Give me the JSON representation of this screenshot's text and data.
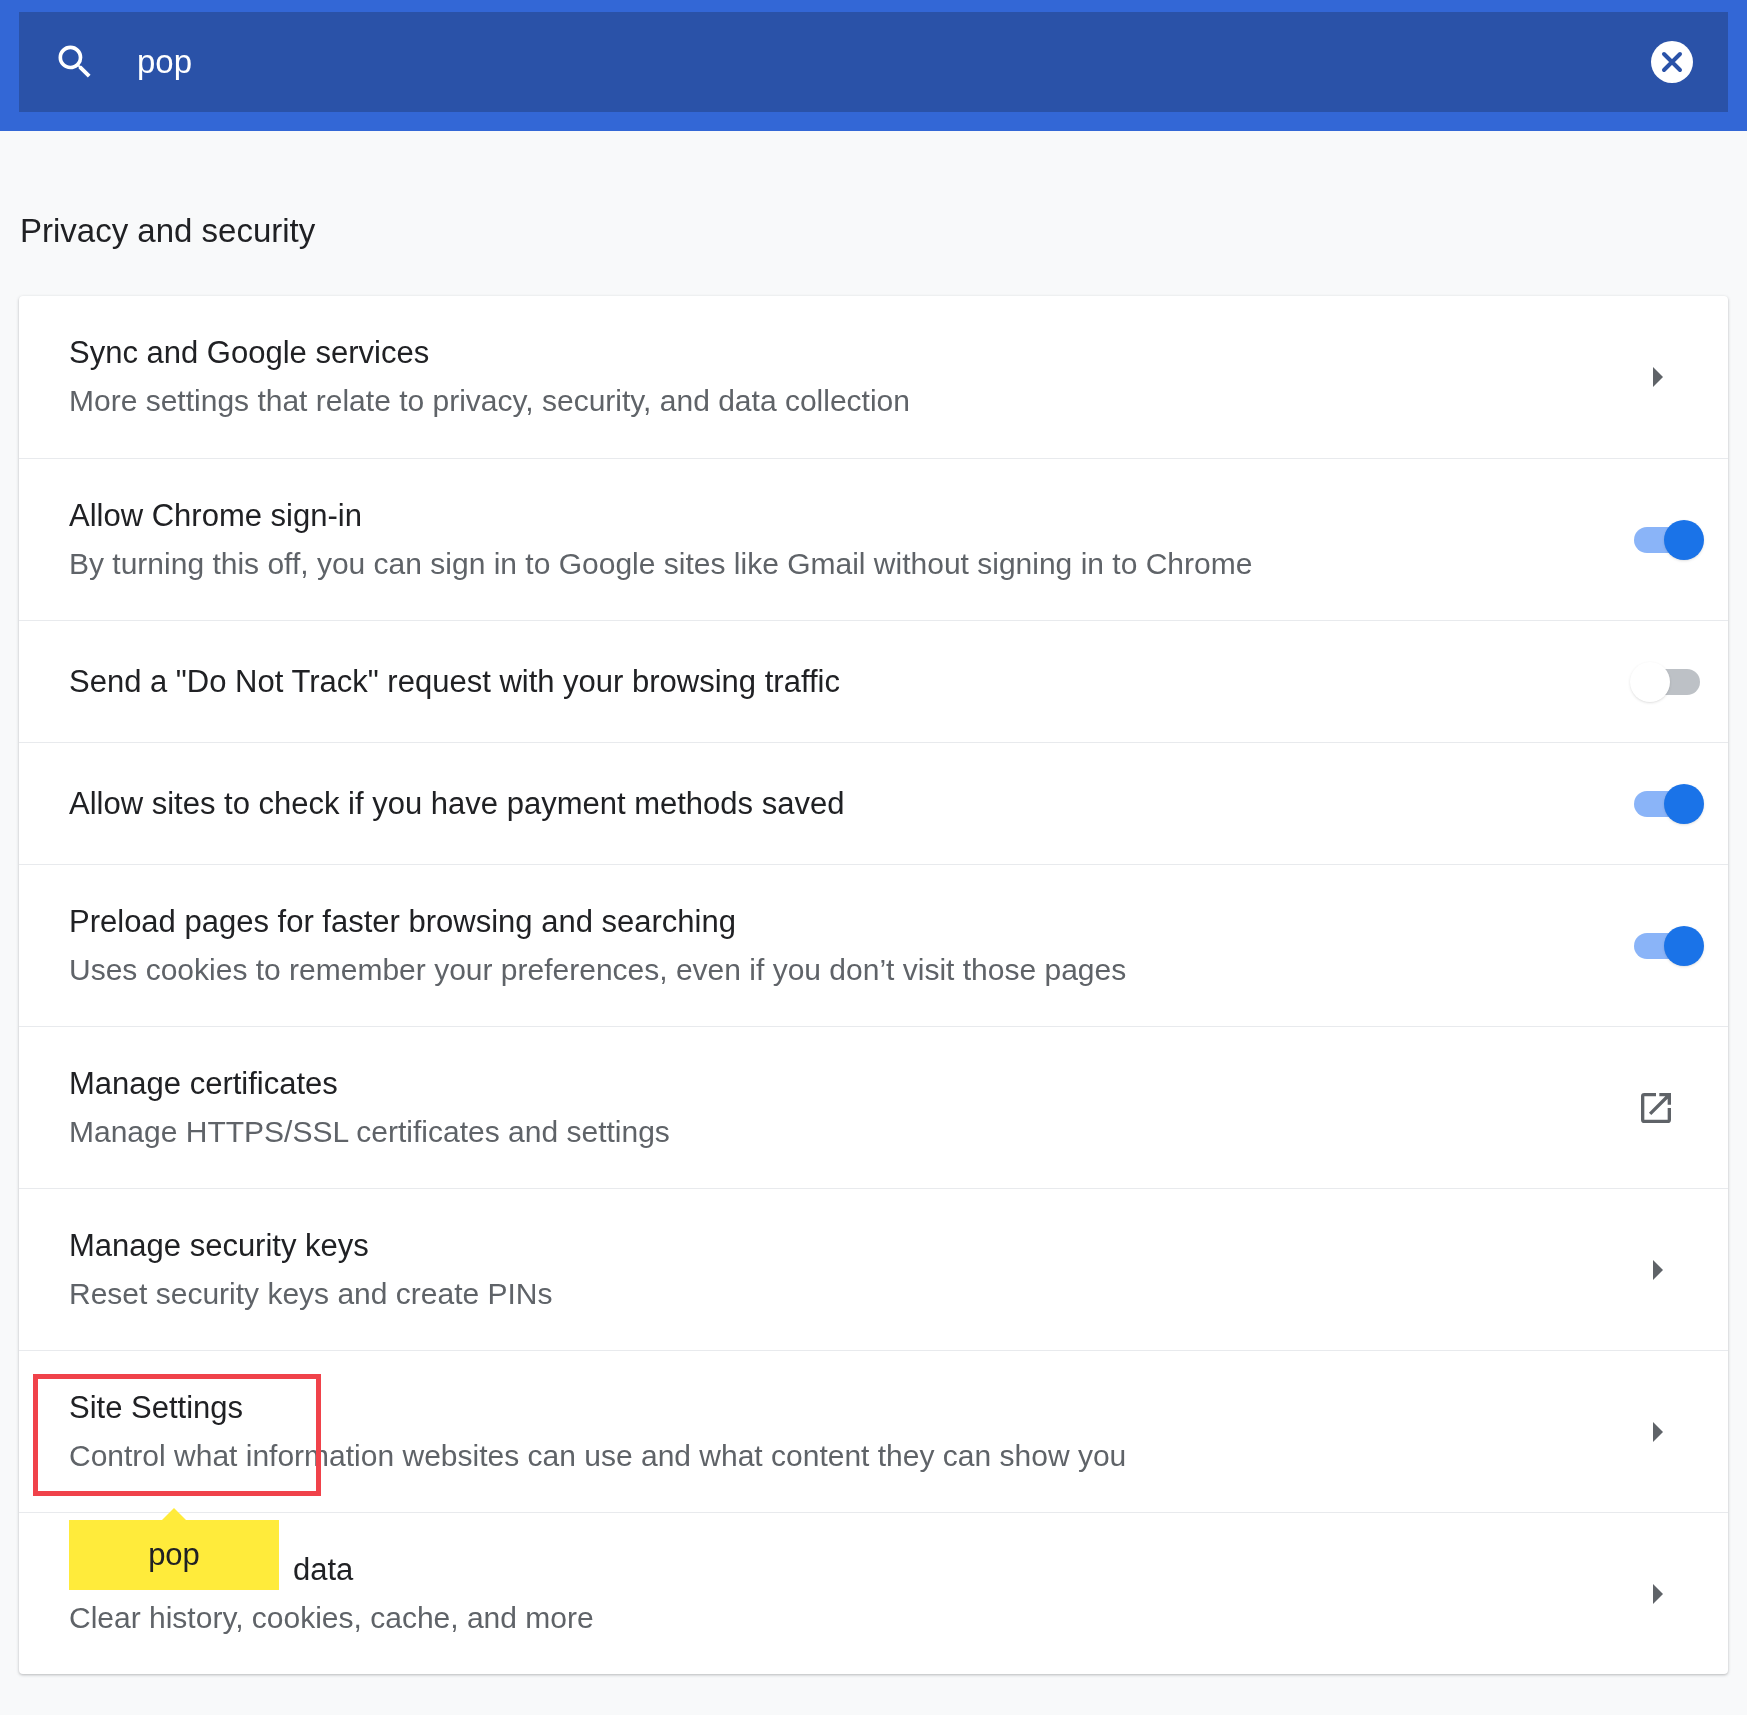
{
  "search": {
    "value": "pop"
  },
  "section_title": "Privacy and security",
  "rows": [
    {
      "kind": "arrow",
      "title": "Sync and Google services",
      "subtitle": "More settings that relate to privacy, security, and data collection"
    },
    {
      "kind": "toggle",
      "title": "Allow Chrome sign-in",
      "subtitle": "By turning this off, you can sign in to Google sites like Gmail without signing in to Chrome",
      "on": true
    },
    {
      "kind": "toggle",
      "title": "Send a \"Do Not Track\" request with your browsing traffic",
      "on": false
    },
    {
      "kind": "toggle",
      "title": "Allow sites to check if you have payment methods saved",
      "on": true
    },
    {
      "kind": "toggle",
      "title": "Preload pages for faster browsing and searching",
      "subtitle": "Uses cookies to remember your preferences, even if you don’t visit those pages",
      "on": true
    },
    {
      "kind": "external",
      "title": "Manage certificates",
      "subtitle": "Manage HTTPS/SSL certificates and settings"
    },
    {
      "kind": "arrow",
      "title": "Manage security keys",
      "subtitle": "Reset security keys and create PINs"
    },
    {
      "kind": "arrow",
      "title": "Site Settings",
      "subtitle": "Control what information websites can use and what content they can show you",
      "search_bubble": "pop"
    },
    {
      "kind": "arrow",
      "title": "data",
      "subtitle": "Clear history, cookies, cache, and more",
      "title_covered": true
    }
  ]
}
